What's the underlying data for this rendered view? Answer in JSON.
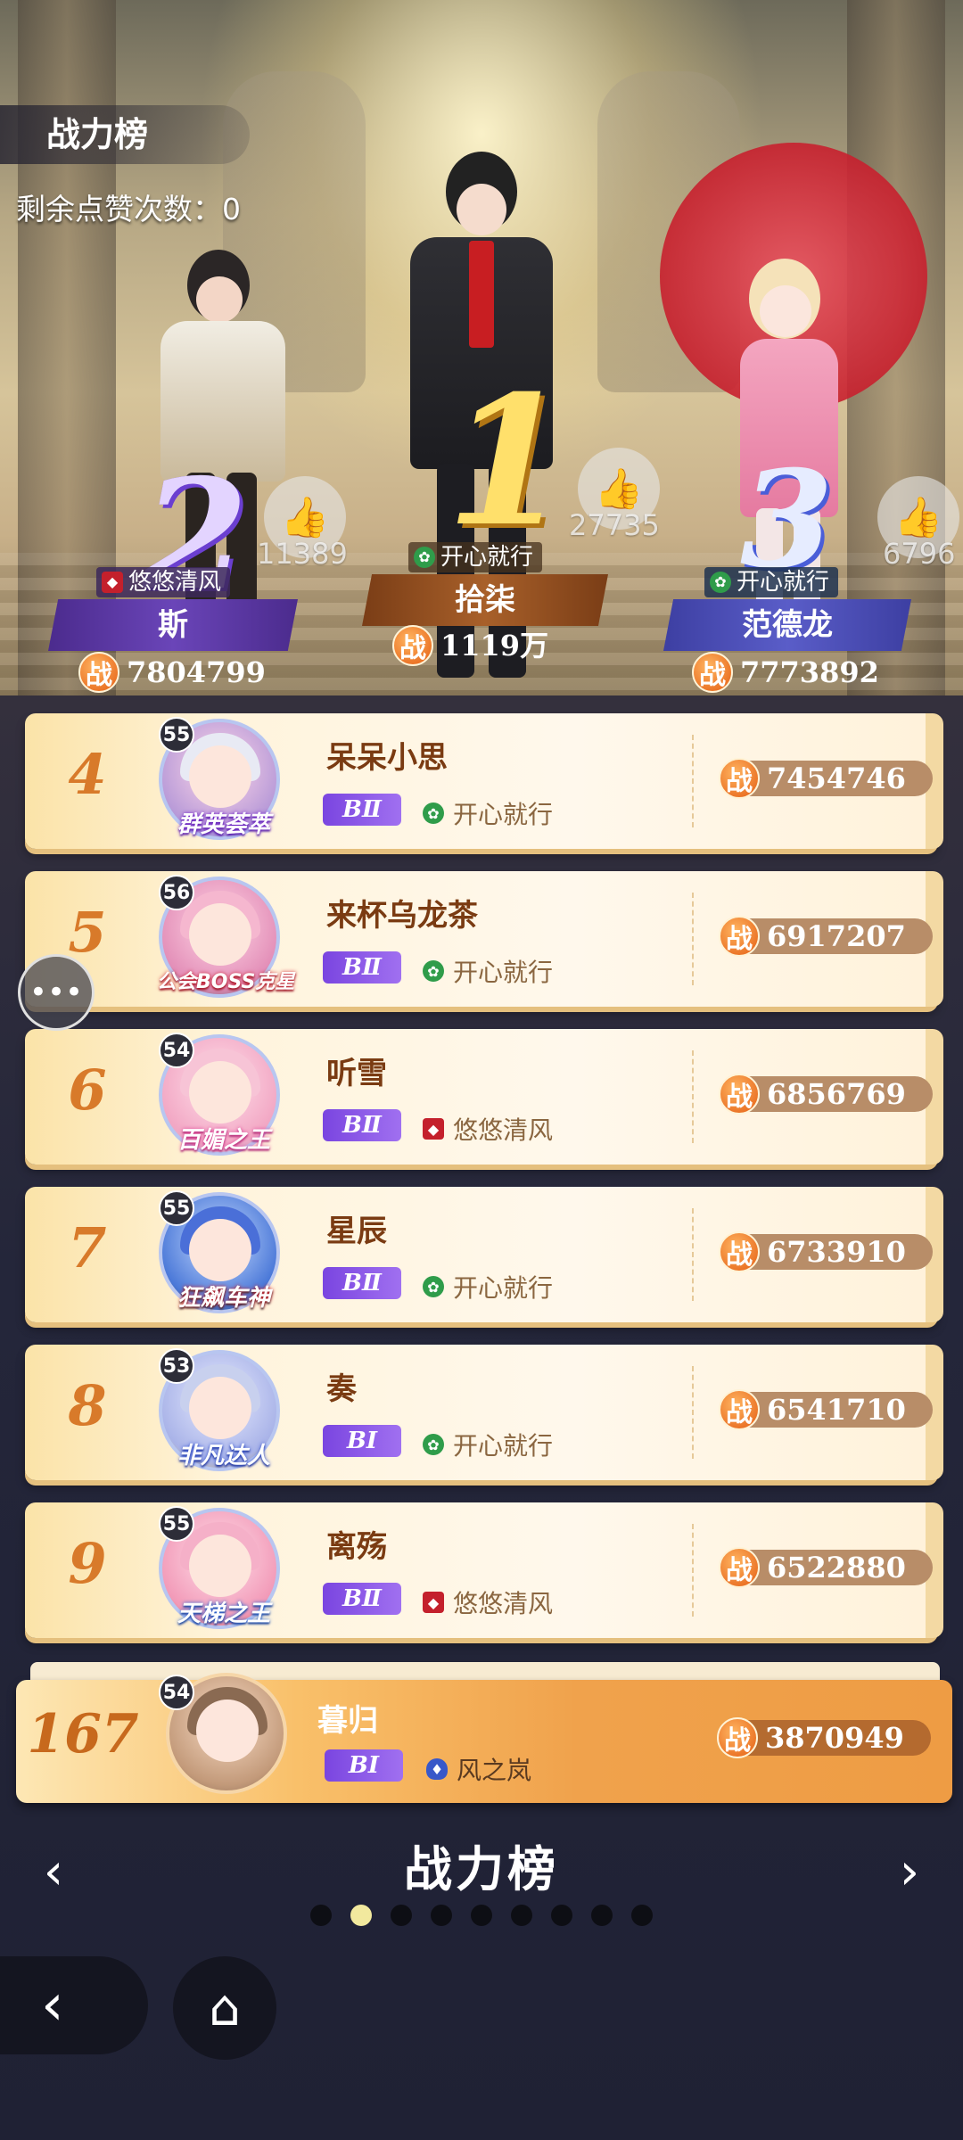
{
  "header": {
    "title": "战力榜",
    "likes_remaining": "剩余点赞次数：0"
  },
  "podium": [
    {
      "rank": "1",
      "name": "拾柒",
      "guild": "开心就行",
      "guild_icon": "guild-green-emblem",
      "power": "1119万",
      "likes": "27735"
    },
    {
      "rank": "2",
      "name": "斯",
      "guild": "悠悠清风",
      "guild_icon": "guild-red-emblem",
      "power": "7804799",
      "likes": "11389"
    },
    {
      "rank": "3",
      "name": "范德龙",
      "guild": "开心就行",
      "guild_icon": "guild-green-emblem",
      "power": "7773892",
      "likes": "6796"
    }
  ],
  "power_icon_label": "战",
  "rows": [
    {
      "rank": "4",
      "level": "55",
      "title": "群英荟萃",
      "name": "呆呆小思",
      "tier": "BⅡ",
      "guild": "开心就行",
      "guild_icon": "guild-green-emblem",
      "power": "7454746"
    },
    {
      "rank": "5",
      "level": "56",
      "title": "公会BOSS克星",
      "name": "来杯乌龙茶",
      "tier": "BⅡ",
      "guild": "开心就行",
      "guild_icon": "guild-green-emblem",
      "power": "6917207"
    },
    {
      "rank": "6",
      "level": "54",
      "title": "百媚之王",
      "name": "听雪",
      "tier": "BⅡ",
      "guild": "悠悠清风",
      "guild_icon": "guild-red-emblem",
      "power": "6856769"
    },
    {
      "rank": "7",
      "level": "55",
      "title": "狂飙车神",
      "name": "星辰",
      "tier": "BⅡ",
      "guild": "开心就行",
      "guild_icon": "guild-green-emblem",
      "power": "6733910"
    },
    {
      "rank": "8",
      "level": "53",
      "title": "非凡达人",
      "name": "奏",
      "tier": "BⅠ",
      "guild": "开心就行",
      "guild_icon": "guild-green-emblem",
      "power": "6541710"
    },
    {
      "rank": "9",
      "level": "55",
      "title": "天梯之王",
      "name": "离殇",
      "tier": "BⅡ",
      "guild": "悠悠清风",
      "guild_icon": "guild-red-emblem",
      "power": "6522880"
    }
  ],
  "self_row": {
    "rank": "167",
    "level": "54",
    "name": "暮归",
    "tier": "BⅠ",
    "guild": "风之岚",
    "guild_icon": "guild-blue-emblem",
    "power": "3870949"
  },
  "footer": {
    "title": "战力榜",
    "page_count": 9,
    "active_page": 2
  },
  "icons": {
    "like": "thumbs-up-icon",
    "chat": "chat-bubble-icon",
    "back": "back-arrow-icon",
    "home": "home-icon",
    "prev": "chevron-left-icon",
    "next": "chevron-right-icon"
  },
  "colors": {
    "rank_number": "#d87a2a",
    "tier_badge": "#8a55e8",
    "power_badge": "#e45d12",
    "dot_active": "#f2e99e"
  }
}
